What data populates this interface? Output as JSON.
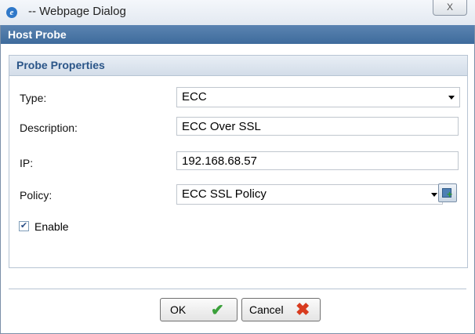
{
  "window": {
    "title": "-- Webpage Dialog",
    "close_glyph": "X",
    "icon": "ie-icon"
  },
  "dialog": {
    "title": "Host Probe"
  },
  "panel": {
    "title": "Probe Properties",
    "fields": {
      "type_label": "Type:",
      "type_value": "ECC",
      "description_label": "Description:",
      "description_value": "ECC Over SSL",
      "ip_label": "IP:",
      "ip_value": "192.168.68.57",
      "policy_label": "Policy:",
      "policy_value": "ECC SSL Policy"
    },
    "enable": {
      "label": "Enable",
      "checked": true
    }
  },
  "buttons": {
    "ok_label": "OK",
    "cancel_label": "Cancel"
  },
  "colors": {
    "header_blue": "#4a76a8",
    "panel_title": "#2a5588",
    "ok_green": "#3aa03a",
    "cancel_red": "#d83b1f"
  }
}
